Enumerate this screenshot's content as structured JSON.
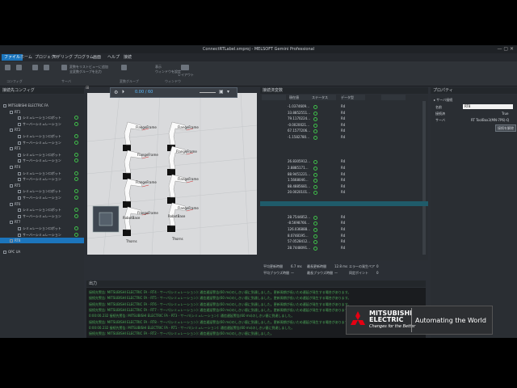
{
  "window": {
    "title": "ConnectRTLabel.smproj - MELSOFT Gemini Professional"
  },
  "menu": {
    "items": [
      "ファイル",
      "ホーム",
      "プロジェクト",
      "モデリング",
      "プログラム",
      "画面",
      "ヘルプ",
      "接続"
    ],
    "active_index": 0
  },
  "ribbon": {
    "groups": [
      "コンフィグ",
      "サーバ",
      "変数グループ",
      "ウィンドウ"
    ],
    "items": [
      "設定",
      "接続",
      "切断",
      "追加",
      "削除",
      "変数をリストビューに追加",
      "全変数グループを出力",
      "変数",
      "ウィンドウを設定",
      "表示",
      "レイアウト"
    ]
  },
  "config_panel": {
    "title": "接続先コンフィグ",
    "root": "MITSUBISHI ELECTRIC FA",
    "robots": [
      {
        "name": "RT1",
        "children": [
          "シミュレーションロボット",
          "サーバーシミュレーション"
        ]
      },
      {
        "name": "RT2",
        "children": [
          "シミュレーションロボット",
          "サーバーシミュレーション"
        ]
      },
      {
        "name": "RT3",
        "children": [
          "シミュレーションロボット",
          "サーバーシミュレーション"
        ]
      },
      {
        "name": "RT4",
        "children": [
          "シミュレーションロボット",
          "サーバーシミュレーション"
        ]
      },
      {
        "name": "RT5",
        "children": [
          "シミュレーションロボット",
          "サーバーシミュレーション"
        ]
      },
      {
        "name": "RT6",
        "children": [
          "シミュレーションロボット",
          "サーバーシミュレーション"
        ]
      },
      {
        "name": "RT7",
        "children": [
          "シミュレーションロボット",
          "サーバーシミュレーション"
        ]
      },
      {
        "name": "RT8",
        "children": []
      }
    ],
    "other": "OPC UA",
    "selected": "RT8"
  },
  "viewport": {
    "toolbar_value": "0.00 / 60",
    "labels": [
      "FlangeFrame",
      "FlangeFrame",
      "FlangeFrame",
      "FlangeFrame",
      "FlangeFrame",
      "FlangeFrame",
      "FlangeFrame",
      "FlangeFrame",
      "RobotBase",
      "RobotBase",
      "Thorns",
      "Thorns"
    ],
    "nav_cube": [
      "T",
      "L",
      "R",
      "B"
    ]
  },
  "vars_panel": {
    "title": "接続済変数",
    "columns": [
      "",
      "現在値",
      "ステータス",
      "データ型",
      ""
    ],
    "rows": [
      {
        "value": "-1.0374609…",
        "type": "R4"
      },
      {
        "value": "33.8852551…",
        "type": "R4"
      },
      {
        "value": "79.1170224…",
        "type": "R4"
      },
      {
        "value": "-0.0020021…",
        "type": "R4"
      },
      {
        "value": "67.1577206…",
        "type": "R4"
      },
      {
        "value": "-1.1582780…",
        "type": "R4"
      },
      {
        "value": "",
        "type": ""
      },
      {
        "value": "",
        "type": ""
      },
      {
        "value": "",
        "type": ""
      },
      {
        "value": "26.8305912…",
        "type": "R4"
      },
      {
        "value": "2.8885171…",
        "type": "R4"
      },
      {
        "value": "88.9451221…",
        "type": "R4"
      },
      {
        "value": "1.5668046…",
        "type": "R4"
      },
      {
        "value": "88.4885681…",
        "type": "R4"
      },
      {
        "value": "20.0020101…",
        "type": "R4"
      },
      {
        "value": "",
        "type": ""
      },
      {
        "value": "",
        "type": ""
      },
      {
        "value": "",
        "type": ""
      },
      {
        "value": "28.7544852…",
        "type": "R4"
      },
      {
        "value": "-8.5698766…",
        "type": "R4"
      },
      {
        "value": "126.036888…",
        "type": "R4"
      },
      {
        "value": "8.0748195…",
        "type": "R4"
      },
      {
        "value": "57.0528412…",
        "type": "R4"
      },
      {
        "value": "28.7448091…",
        "type": "R4"
      }
    ],
    "stats": [
      {
        "label": "平均更新時間",
        "value": "6.7 ms"
      },
      {
        "label": "最長更新時間",
        "value": "12.8 ms"
      },
      {
        "label": "エラーの発生ペア",
        "value": "0"
      },
      {
        "label": "平均ブラウズ時間",
        "value": "—"
      },
      {
        "label": "最長ブラウズ時間",
        "value": "—"
      },
      {
        "label": "同定ポイント",
        "value": "0"
      }
    ]
  },
  "properties": {
    "title": "プロパティ",
    "section": "サーバ接続",
    "rows": [
      {
        "label": "名前",
        "value": "RT8"
      },
      {
        "label": "接続済",
        "value": "True"
      },
      {
        "label": "サーバ",
        "value": "RT ToolBox3(MN-7P6)-Q"
      }
    ],
    "button": "接続を解除"
  },
  "output": {
    "title": "出力",
    "lines": [
      "接続先警告: MITSUBISHI ELECTRIC FA - RT4 - サーバ(シミュレーション): 通信遅延警告(60 ms)のしきい値に到達しました。更新周期が長いため遅延が発生する場合があります。",
      "接続先警告: MITSUBISHI ELECTRIC FA - RT5 - サーバ(シミュレーション): 通信遅延警告(60 ms)のしきい値に到達しました。更新周期が長いため遅延が発生する場合があります。",
      "接続先警告: MITSUBISHI ELECTRIC FA - RT6 - サーバ(シミュレーション): 通信遅延警告(60 ms)のしきい値に到達しました。更新周期が長いため遅延が発生する場合があります。",
      "接続先警告: MITSUBISHI ELECTRIC FA - RT7 - サーバ(シミュレーション): 通信遅延警告(60 ms)のしきい値に到達しました。更新周期が長いため遅延が発生する場合があります。",
      "0:00:00.232 接続先警告: MITSUBISHI ELECTRIC FA - RT3 - サーバ(シミュレーション): 通信遅延警告(60 ms)のしきい値に到達しました。",
      "接続先警告: MITSUBISHI ELECTRIC FA - RT8 - サーバ(シミュレーション): 通信遅延警告(60 ms)のしきい値に到達しました。更新周期が長いため遅延が発生する場合があります。",
      "0:00:00.232 接続先警告: MITSUBISHI ELECTRIC FA - RT1 - サーバ(シミュレーション): 通信遅延警告(60 ms)のしきい値に到達しました。",
      "接続先警告: MITSUBISHI ELECTRIC FA - RT2 - サーバ(シミュレーション): 通信遅延警告(60 ms)のしきい値に到達しました。"
    ]
  },
  "banner": {
    "brand_line1": "MITSUBISHI",
    "brand_line2": "ELECTRIC",
    "tagline": "Changes for the Better",
    "slogan": "Automating the World",
    "brand_color": "#e60012"
  }
}
